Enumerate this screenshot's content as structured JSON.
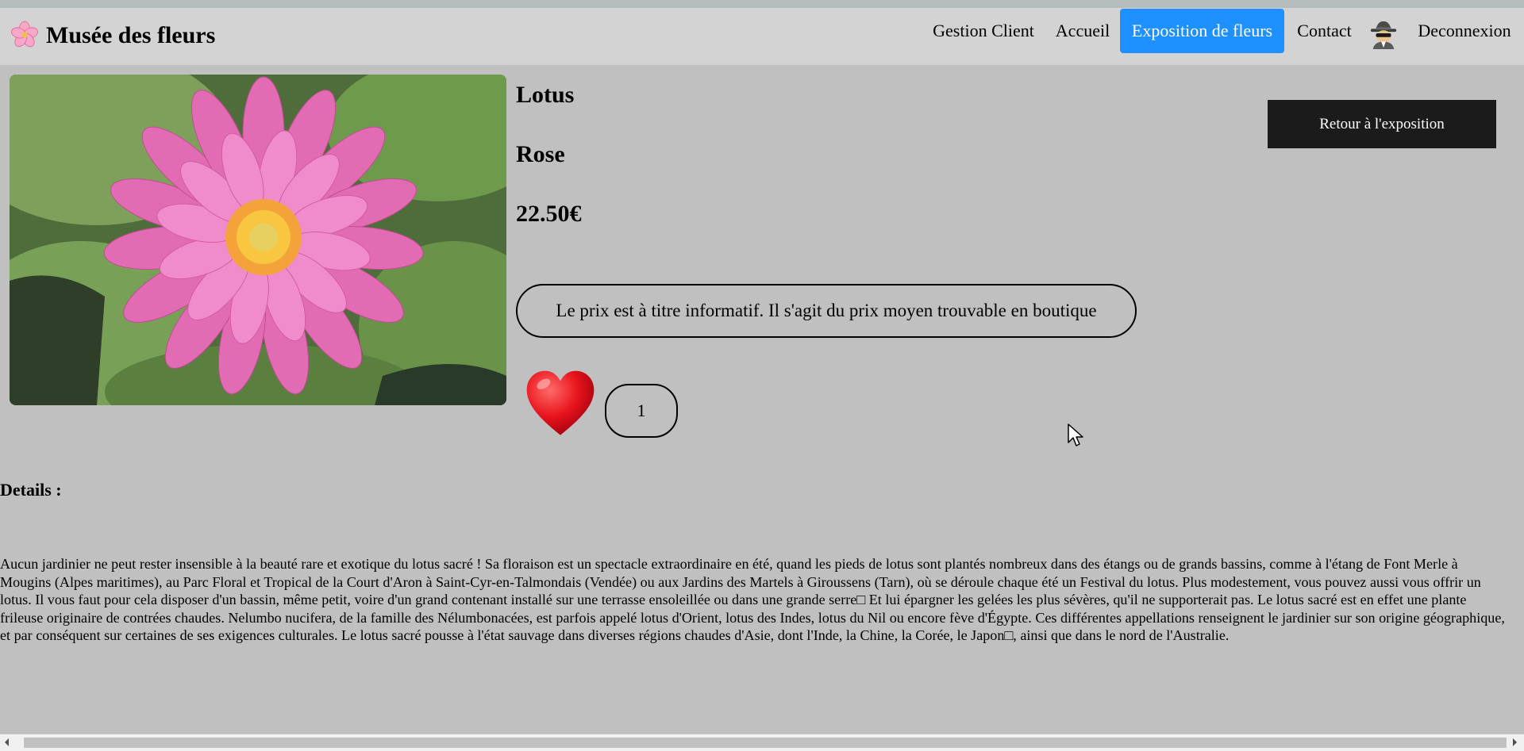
{
  "header": {
    "brand": "Musée des fleurs",
    "logo_icon": "cherry-blossom-icon",
    "nav": {
      "gestion_client": "Gestion Client",
      "accueil": "Accueil",
      "exposition": "Exposition de fleurs",
      "contact": "Contact",
      "deconnexion": "Deconnexion"
    },
    "user_icon": "spy-icon",
    "active_color": "#1e90ff"
  },
  "product": {
    "image_icon": "pink-lotus-flower-photo",
    "name": "Lotus",
    "color": "Rose",
    "price": "22.50€",
    "back_button": "Retour à l'exposition",
    "price_notice": "Le prix est à titre informatif. Il s'agit du prix moyen trouvable en boutique",
    "like_icon": "heart-icon",
    "like_count": "1"
  },
  "details": {
    "label": "Details :",
    "text": "Aucun jardinier ne peut rester insensible à la beauté rare et exotique du lotus sacré ! Sa floraison est un spectacle extraordinaire en été, quand les pieds de lotus sont plantés nombreux dans des étangs ou de grands bassins, comme à l'étang de Font Merle à Mougins (Alpes maritimes), au Parc Floral et Tropical de la Court d'Aron à Saint-Cyr-en-Talmondais (Vendée) ou aux Jardins des Martels à Giroussens (Tarn), où se déroule chaque été un Festival du lotus. Plus modestement, vous pouvez aussi vous offrir un lotus. Il vous faut pour cela disposer d'un bassin, même petit, voire d'un grand contenant installé sur une terrasse ensoleillée ou dans une grande serre□ Et lui épargner les gelées les plus sévères, qu'il ne supporterait pas. Le lotus sacré est en effet une plante frileuse originaire de contrées chaudes. Nelumbo nucifera, de la famille des Nélumbonacées, est parfois appelé lotus d'Orient, lotus des Indes, lotus du Nil ou encore fève d'Égypte. Ces différentes appellations renseignent le jardinier sur son origine géographique, et par conséquent sur certaines de ses exigences culturales. Le lotus sacré pousse à l'état sauvage dans diverses régions chaudes d'Asie, dont l'Inde, la Chine, la Corée, le Japon□, ainsi que dans le nord de l'Australie."
  }
}
